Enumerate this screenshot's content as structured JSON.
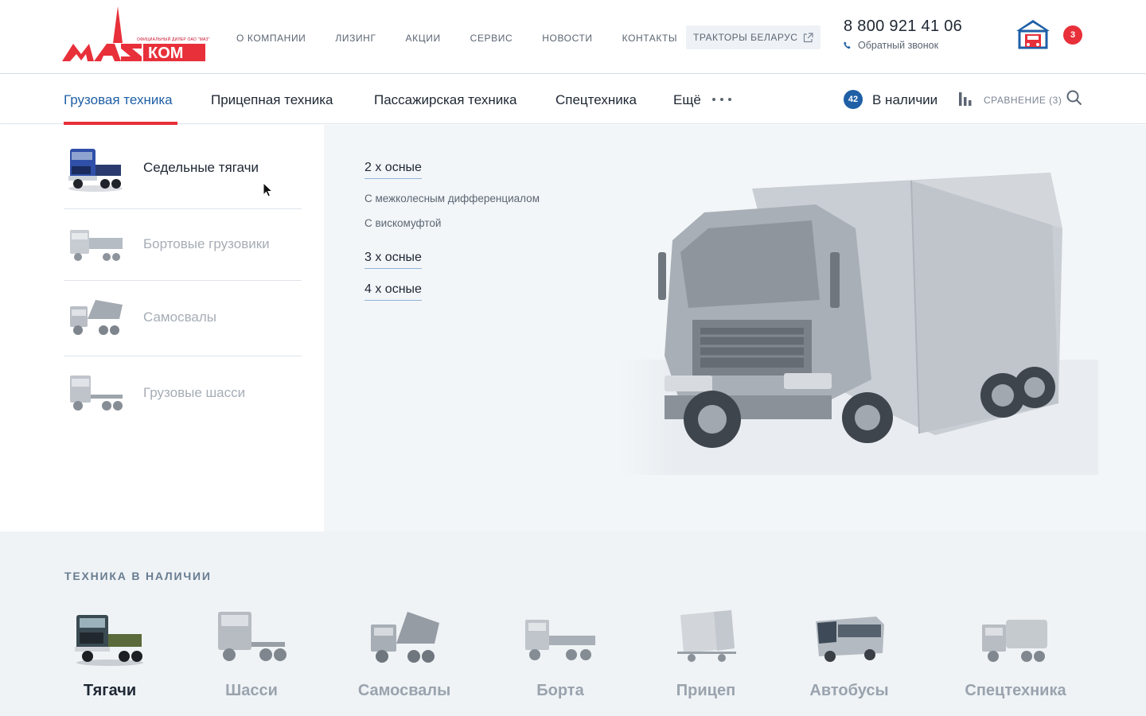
{
  "header": {
    "logo_text": "МАЗКОМ",
    "logo_subtitle": "ОФИЦИАЛЬНЫЙ ДИЛЕР ОАО \"МАЗ\"",
    "nav": [
      "О КОМПАНИИ",
      "ЛИЗИНГ",
      "АКЦИИ",
      "СЕРВИС",
      "НОВОСТИ",
      "КОНТАКТЫ"
    ],
    "tractors_link": "ТРАКТОРЫ БЕЛАРУС",
    "phone": "8 800 921 41 06",
    "callback": "Обратный звонок",
    "garage_count": "3"
  },
  "mainnav": {
    "items": [
      "Грузовая техника",
      "Прицепная техника",
      "Пассажирская техника",
      "Спецтехника",
      "Ещё"
    ],
    "active_index": 0,
    "stock_count": "42",
    "stock_label": "В наличии",
    "compare_label": "СРАВНЕНИЕ (3)"
  },
  "dropdown": {
    "categories": [
      "Седельные тягачи",
      "Бортовые грузовики",
      "Самосвалы",
      "Грузовые шасси"
    ],
    "active_category": 0,
    "subitems": {
      "axle2": "2 х осные",
      "diff": "С межколесным дифференциалом",
      "viscous": "С вискомуфтой",
      "axle3": "3 х осные",
      "axle4": "4 х осные"
    }
  },
  "stock": {
    "title": "ТЕХНИКА В НАЛИЧИИ",
    "items": [
      "Тягачи",
      "Шасси",
      "Самосвалы",
      "Борта",
      "Прицеп",
      "Автобусы",
      "Спецтехника"
    ],
    "active_index": 0
  },
  "colors": {
    "brand_red": "#e8303a",
    "brand_blue": "#1f5fa6",
    "text_dark": "#1e2733",
    "text_muted": "#5b6572"
  }
}
